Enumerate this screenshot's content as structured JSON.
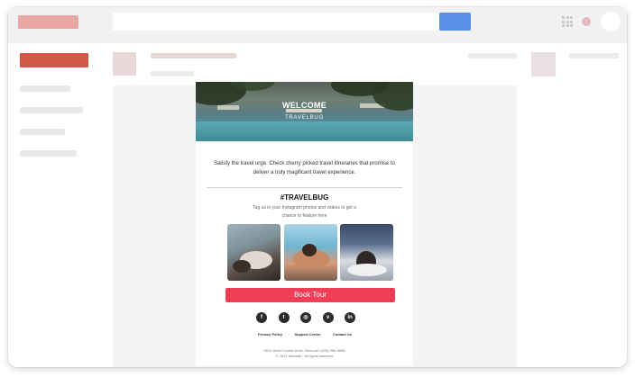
{
  "email": {
    "hero_title": "WELCOME",
    "hero_subtitle": "TRAVELBUG",
    "intro_text": "Satisfy the travel urge. Check cherry picked travel itineraries that promise to deliver a truly magificant travel experience.",
    "tag_title": "#TRAVELBUG",
    "tag_description": "Tag us in your Instagram photos and videos to get a chance to feature here",
    "cta_label": "Book Tour",
    "social": [
      {
        "name": "facebook-icon",
        "glyph": "f"
      },
      {
        "name": "twitter-icon",
        "glyph": "t"
      },
      {
        "name": "instagram-icon",
        "glyph": "◎"
      },
      {
        "name": "vimeo-icon",
        "glyph": "v"
      },
      {
        "name": "linkedin-icon",
        "glyph": "in"
      }
    ],
    "footer_links": [
      "Privacy Policy",
      "Support Centre",
      "Contact Us"
    ],
    "address": "5812 Shell Course Drive, Remont1 (028) 985 5058",
    "copyright": "© 2021 Website · All rights reserved"
  },
  "colors": {
    "accent": "#ef3e56",
    "search_button": "#5c8fe6",
    "compose_button": "#d15848"
  }
}
